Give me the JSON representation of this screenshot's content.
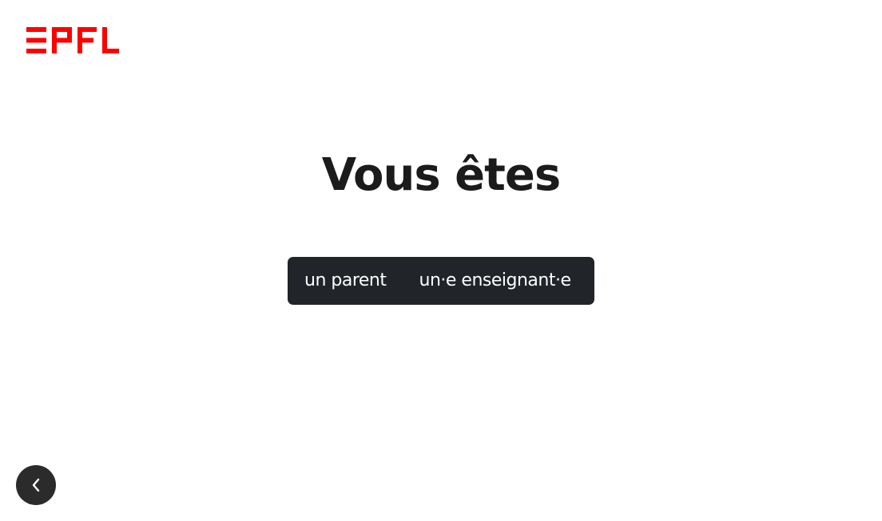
{
  "header": {
    "logo_text": "EPFL",
    "logo_color": "#ff0000"
  },
  "main": {
    "title": "Vous êtes",
    "choices": [
      {
        "label": "un parent"
      },
      {
        "label": "un·e enseignant·e"
      }
    ],
    "choice_group_color": "#212529"
  },
  "nav": {
    "back_icon": "chevron-left-icon"
  }
}
